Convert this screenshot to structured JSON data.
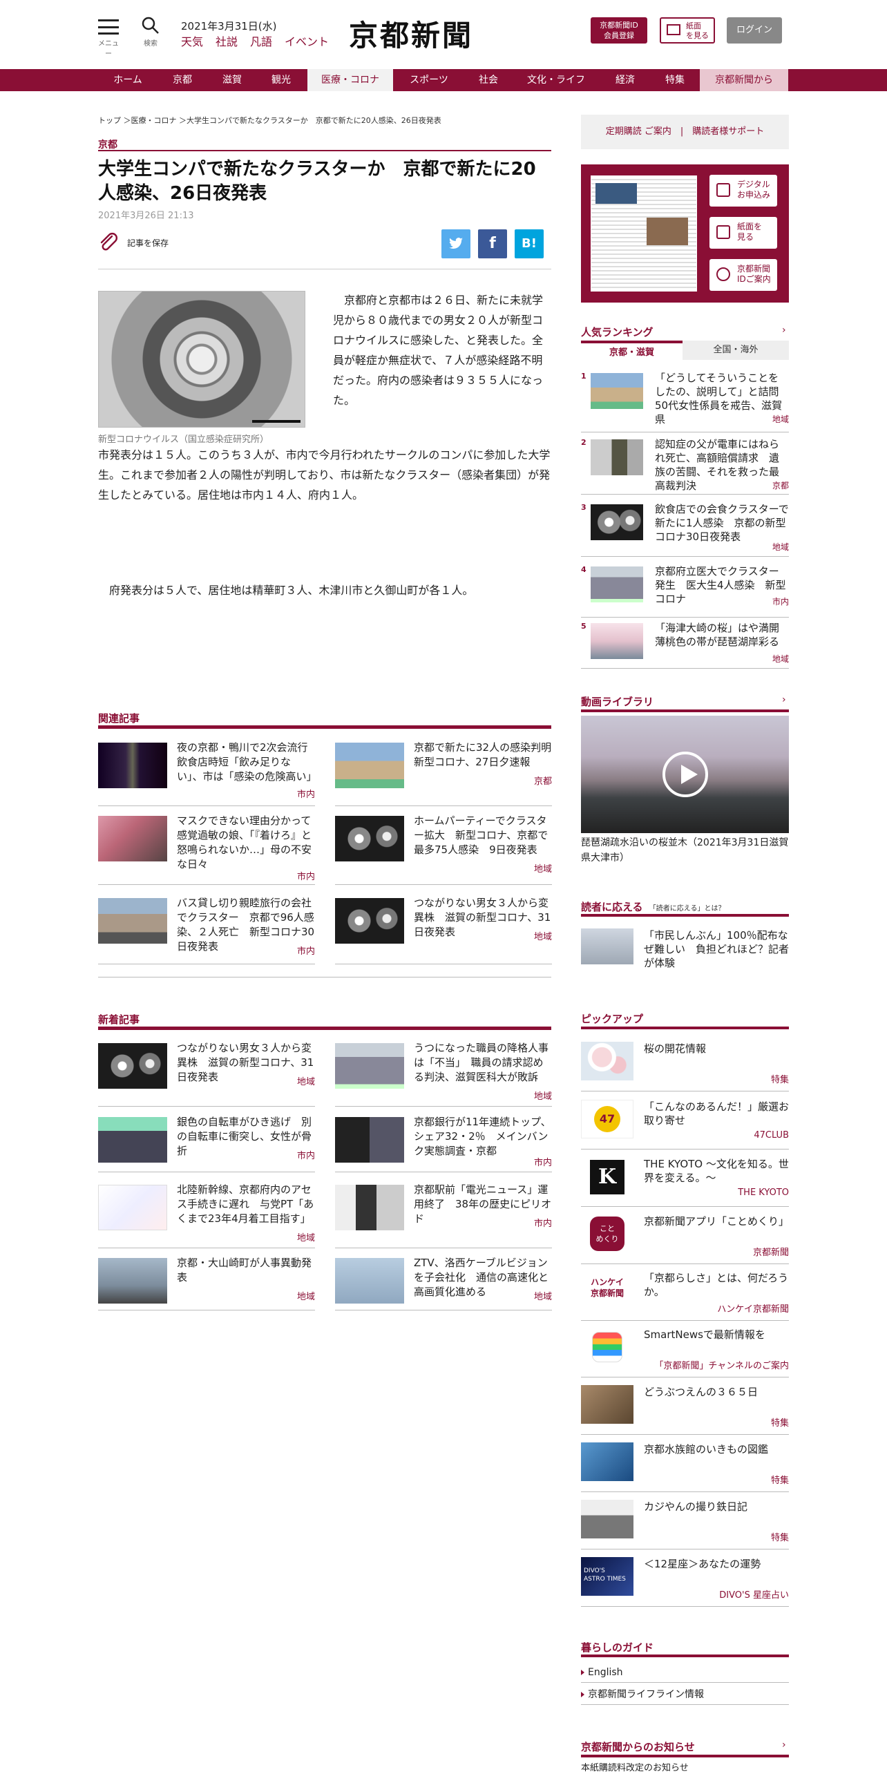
{
  "header": {
    "menu_caption": "メニュー",
    "search_caption": "検索",
    "date": "2021年3月31日(水)",
    "quick_links": [
      "天気",
      "社説",
      "凡語",
      "イベント"
    ],
    "logo": "京都新聞",
    "id_button": [
      "京都新聞ID",
      "会員登録"
    ],
    "paper_button": [
      "紙面",
      "を見る"
    ],
    "login_button": "ログイン"
  },
  "nav": {
    "items": [
      "ホーム",
      "京都",
      "滋賀",
      "観光",
      "医療・コロナ",
      "スポーツ",
      "社会",
      "文化・ライフ",
      "経済",
      "特集",
      "京都新聞から"
    ],
    "active": "医療・コロナ"
  },
  "breadcrumb": "トップ ＞医療・コロナ ＞大学生コンパで新たなクラスターか　京都で新たに20人感染、26日夜発表",
  "article": {
    "category": "京都",
    "title": "大学生コンパで新たなクラスターか　京都で新たに20人感染、26日夜発表",
    "date": "2021年3月26日 21:13",
    "save_label": "記事を保存",
    "share": [
      "twitter",
      "facebook",
      "B!"
    ],
    "photo_caption": "新型コロナウイルス（国立感染症研究所）",
    "paragraphs": [
      "京都府と京都市は２６日、新たに未就学児から８０歳代までの男女２０人が新型コロナウイルスに感染した、と発表した。全員が軽症か無症状で、７人が感染経路不明だった。府内の感染者は９３５５人になった。",
      "市発表分は１５人。このうち３人が、市内で今月行われたサークルのコンパに参加した大学生。これまで参加者２人の陽性が判明しており、市は新たなクラスター（感染者集団）が発生したとみている。居住地は市内１４人、府内１人。",
      "府発表分は５人で、居住地は精華町３人、木津川市と久御山町が各１人。"
    ]
  },
  "related": {
    "title": "関連記事",
    "items": [
      {
        "text": "夜の京都・鴨川で2次会流行　飲食店時短「飲み足りない」、市は「感染の危険高い」",
        "tag": "市内"
      },
      {
        "text": "京都で新たに32人の感染判明　新型コロナ、27日夕速報",
        "tag": "京都"
      },
      {
        "text": "マスクできない理由分かって　感覚過敏の娘、「『着けろ』と怒鳴られないか…」母の不安な日々",
        "tag": "市内"
      },
      {
        "text": "ホームパーティーでクラスター拡大　新型コロナ、京都で最多75人感染　9日夜発表",
        "tag": "地域"
      },
      {
        "text": "バス貸し切り親睦旅行の会社でクラスター　京都で96人感染、２人死亡　新型コロナ30日夜発表",
        "tag": "市内"
      },
      {
        "text": "つながりない男女３人から変異株　滋賀の新型コロナ、31日夜発表",
        "tag": "地域"
      }
    ]
  },
  "latest": {
    "title": "新着記事",
    "items": [
      {
        "text": "つながりない男女３人から変異株　滋賀の新型コロナ、31日夜発表",
        "tag": "地域"
      },
      {
        "text": "うつになった職員の降格人事は「不当」　職員の請求認める判決、滋賀医科大が敗訴",
        "tag": "地域"
      },
      {
        "text": "銀色の自転車がひき逃げ　別の自転車に衝突し、女性が骨折",
        "tag": "市内"
      },
      {
        "text": "京都銀行が11年連続トップ、シェア32・2％　メインバンク実態調査・京都",
        "tag": "市内"
      },
      {
        "text": "北陸新幹線、京都府内のアセス手続きに遅れ　与党PT「あくまで23年4月着工目指す」",
        "tag": "地域"
      },
      {
        "text": "京都駅前「電光ニュース」運用終了　38年の歴史にピリオド",
        "tag": "市内"
      },
      {
        "text": "京都・大山崎町が人事異動発表",
        "tag": "地域"
      },
      {
        "text": "ZTV、洛西ケーブルビジョンを子会社化　通信の高速化と高画質化進める",
        "tag": "地域"
      }
    ]
  },
  "sidebar": {
    "top_links": "定期購読 ご案内　|　購読者様サポート",
    "paper_box": {
      "buttons": [
        [
          "デジタル",
          "お申込み"
        ],
        [
          "紙面を",
          "見る"
        ],
        [
          "京都新聞",
          "IDご案内"
        ]
      ]
    },
    "ranking": {
      "title": "人気ランキング",
      "chevron": "›",
      "tabs": [
        "京都・滋賀",
        "全国・海外"
      ],
      "items": [
        {
          "num": "1",
          "text": "「どうしてそういうことをしたの、説明して」と詰問　50代女性係員を戒告、滋賀県",
          "tag": "地域"
        },
        {
          "num": "2",
          "text": "認知症の父が電車にはねられ死亡、高額賠償請求　遺族の苦闘、それを救った最高裁判決",
          "tag": "京都"
        },
        {
          "num": "3",
          "text": "飲食店での会食クラスターで新たに1人感染　京都の新型コロナ30日夜発表",
          "tag": "地域"
        },
        {
          "num": "4",
          "text": "京都府立医大でクラスター発生　医大生4人感染　新型コロナ",
          "tag": "市内"
        },
        {
          "num": "5",
          "text": "「海津大崎の桜」はや満開　薄桃色の帯が琵琶湖岸彩る",
          "tag": "地域"
        }
      ]
    },
    "video": {
      "title": "動画ライブラリ",
      "chevron": "›",
      "caption": "琵琶湖疏水沿いの桜並木（2021年3月31日滋賀県大津市）"
    },
    "readers": {
      "title": "読者に応える",
      "sub": "「読者に応える」とは？",
      "text": "「市民しんぶん」100％配布なぜ難しい　負担どれほど？記者が体験"
    },
    "pickup": {
      "title": "ピックアップ",
      "items": [
        {
          "text": "桜の開花情報",
          "tag": "特集"
        },
        {
          "text": "「こんなのあるんだ！」厳選お取り寄せ",
          "tag": "47CLUB"
        },
        {
          "text": "THE KYOTO ～文化を知る。世界を変える。～",
          "tag": "THE KYOTO"
        },
        {
          "text": "京都新聞アプリ「ことめくり」",
          "tag": "京都新聞"
        },
        {
          "text": "「京都らしさ」とは、何だろうか。",
          "tag": "ハンケイ京都新聞"
        },
        {
          "text": "SmartNewsで最新情報を",
          "tag": "「京都新聞」チャンネルのご案内"
        },
        {
          "text": "どうぶつえんの３６５日",
          "tag": "特集"
        },
        {
          "text": "京都水族館のいきもの図鑑",
          "tag": "特集"
        },
        {
          "text": "カジやんの撮り鉄日記",
          "tag": "特集"
        },
        {
          "text": "＜12星座＞あなたの運勢",
          "tag": "DIVO'S 星座占い"
        }
      ],
      "logo_texts": {
        "47": "47",
        "k": "K",
        "app": "こと\nめくり",
        "hk": "ハンケイ\n京都新聞",
        "astro": "DIVO'S\nASTRO TIMES"
      }
    },
    "guide": {
      "title": "暮らしのガイド",
      "items": [
        "English",
        "京都新聞ライフライン情報"
      ]
    },
    "notice": {
      "title": "京都新聞からのお知らせ",
      "chevron": "›",
      "first": "本紙購読料改定のお知らせ"
    }
  }
}
